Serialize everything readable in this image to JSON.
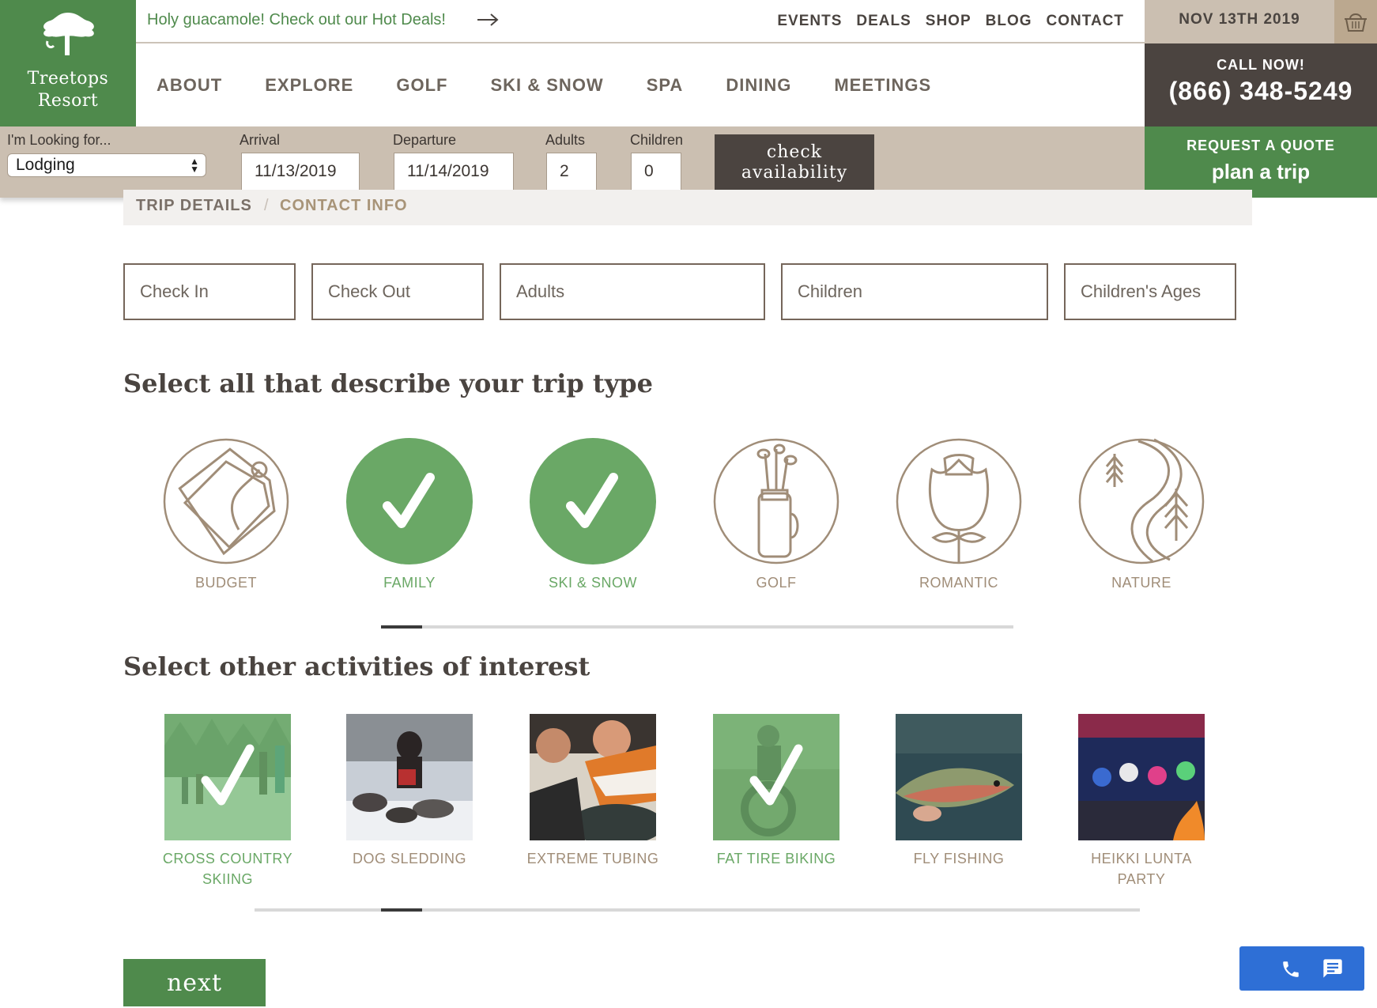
{
  "brand": {
    "name_line1": "Treetops",
    "name_line2": "Resort"
  },
  "promo": {
    "text": "Holy guacamole! Check out our Hot Deals!"
  },
  "top_nav": [
    "EVENTS",
    "DEALS",
    "SHOP",
    "BLOG",
    "CONTACT"
  ],
  "date_display": "NOV 13TH 2019",
  "main_nav": [
    "ABOUT",
    "EXPLORE",
    "GOLF",
    "SKI & SNOW",
    "SPA",
    "DINING",
    "MEETINGS"
  ],
  "call": {
    "label": "CALL NOW!",
    "phone": "(866) 348-5249"
  },
  "search": {
    "looking_label": "I'm Looking for...",
    "looking_value": "Lodging",
    "arrival_label": "Arrival",
    "arrival_value": "11/13/2019",
    "departure_label": "Departure",
    "departure_value": "11/14/2019",
    "adults_label": "Adults",
    "adults_value": "2",
    "children_label": "Children",
    "children_value": "0",
    "check_line1": "check",
    "check_line2": "availability"
  },
  "quote": {
    "line1": "REQUEST A QUOTE",
    "line2": "plan a trip"
  },
  "breadcrumb": {
    "step1": "TRIP DETAILS",
    "separator": "/",
    "step2": "CONTACT INFO"
  },
  "trip_inputs": {
    "check_in": "Check In",
    "check_out": "Check Out",
    "adults": "Adults",
    "children": "Children",
    "children_ages": "Children's Ages"
  },
  "trip_type_heading": "Select all that describe your trip type",
  "trip_types": [
    {
      "label": "BUDGET",
      "icon": "price-tag-icon",
      "selected": false
    },
    {
      "label": "FAMILY",
      "icon": "checkmark-icon",
      "selected": true
    },
    {
      "label": "SKI & SNOW",
      "icon": "checkmark-icon",
      "selected": true
    },
    {
      "label": "GOLF",
      "icon": "golf-bag-icon",
      "selected": false
    },
    {
      "label": "ROMANTIC",
      "icon": "rose-icon",
      "selected": false
    },
    {
      "label": "NATURE",
      "icon": "river-trees-icon",
      "selected": false
    }
  ],
  "activities_heading": "Select other activities of interest",
  "activities": [
    {
      "label_line1": "CROSS COUNTRY",
      "label_line2": "SKIING",
      "selected": true
    },
    {
      "label_line1": "DOG SLEDDING",
      "label_line2": "",
      "selected": false
    },
    {
      "label_line1": "EXTREME TUBING",
      "label_line2": "",
      "selected": false
    },
    {
      "label_line1": "FAT TIRE BIKING",
      "label_line2": "",
      "selected": true
    },
    {
      "label_line1": "FLY FISHING",
      "label_line2": "",
      "selected": false
    },
    {
      "label_line1": "HEIKKI LUNTA",
      "label_line2": "PARTY",
      "selected": false
    }
  ],
  "next_label": "next",
  "colors": {
    "brand_green": "#4f8a4c",
    "selected_green": "#6aa866",
    "tan": "#cbbfb1",
    "dark_brown": "#4b4440",
    "icon_brown": "#a08d78",
    "chat_blue": "#2e6fd6"
  }
}
